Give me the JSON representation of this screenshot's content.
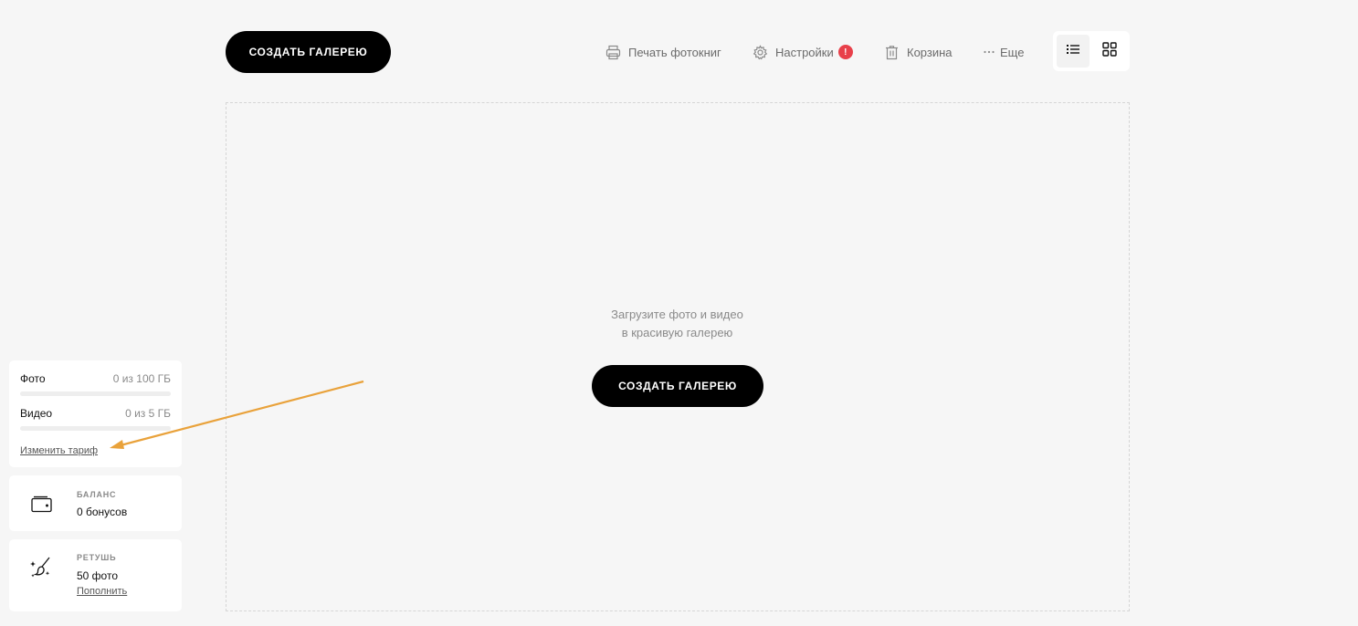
{
  "header": {
    "create_gallery_label": "СОЗДАТЬ ГАЛЕРЕЮ",
    "print_books_label": "Печать фотокниг",
    "settings_label": "Настройки",
    "settings_badge": "!",
    "trash_label": "Корзина",
    "more_label": "Еще",
    "view_mode": "list"
  },
  "main": {
    "empty_line1": "Загрузите фото и видео",
    "empty_line2": "в красивую галерею",
    "create_gallery_label": "СОЗДАТЬ ГАЛЕРЕЮ"
  },
  "sidebar": {
    "storage": {
      "photo_label": "Фото",
      "photo_value": "0 из 100 ГБ",
      "photo_used_fraction": 0,
      "video_label": "Видео",
      "video_value": "0 из 5 ГБ",
      "video_used_fraction": 0,
      "change_plan_label": "Изменить тариф"
    },
    "balance": {
      "title": "БАЛАНС",
      "value": "0 бонусов"
    },
    "retouch": {
      "title": "РЕТУШЬ",
      "value": "50 фото",
      "topup_label": "Пополнить"
    }
  },
  "colors": {
    "background": "#f6f6f6",
    "button": "#000000",
    "badge": "#e8404a",
    "annotation_arrow": "#e9a23b"
  }
}
